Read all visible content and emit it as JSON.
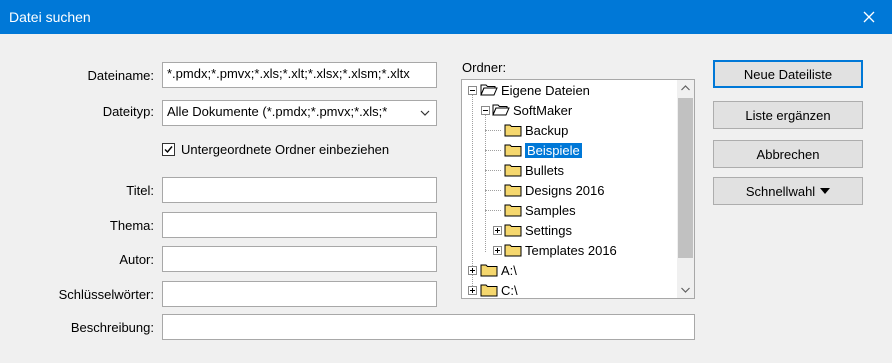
{
  "window": {
    "title": "Datei suchen"
  },
  "form": {
    "dateiname_label": "Dateiname:",
    "dateiname_value": "*.pmdx;*.pmvx;*.xls;*.xlt;*.xlsx;*.xlsm;*.xltx",
    "dateityp_label": "Dateityp:",
    "dateityp_value": "Alle Dokumente (*.pmdx;*.pmvx;*.xls;*",
    "subfolders_label": "Untergeordnete Ordner einbeziehen",
    "subfolders_checked": true,
    "titel_label": "Titel:",
    "thema_label": "Thema:",
    "autor_label": "Autor:",
    "keywords_label": "Schlüsselwörter:",
    "beschreibung_label": "Beschreibung:"
  },
  "folders": {
    "label": "Ordner:",
    "items": [
      {
        "label": "Eigene Dateien"
      },
      {
        "label": "SoftMaker"
      },
      {
        "label": "Backup"
      },
      {
        "label": "Beispiele"
      },
      {
        "label": "Bullets"
      },
      {
        "label": "Designs 2016"
      },
      {
        "label": "Samples"
      },
      {
        "label": "Settings"
      },
      {
        "label": "Templates 2016"
      },
      {
        "label": "A:\\"
      },
      {
        "label": "C:\\"
      }
    ],
    "selected": "Beispiele"
  },
  "buttons": {
    "new_list": "Neue Dateiliste",
    "extend_list": "Liste ergänzen",
    "cancel": "Abbrechen",
    "quick_select": "Schnellwahl"
  },
  "colors": {
    "accent": "#0078d7",
    "folder_fill": "#f5d76e"
  }
}
